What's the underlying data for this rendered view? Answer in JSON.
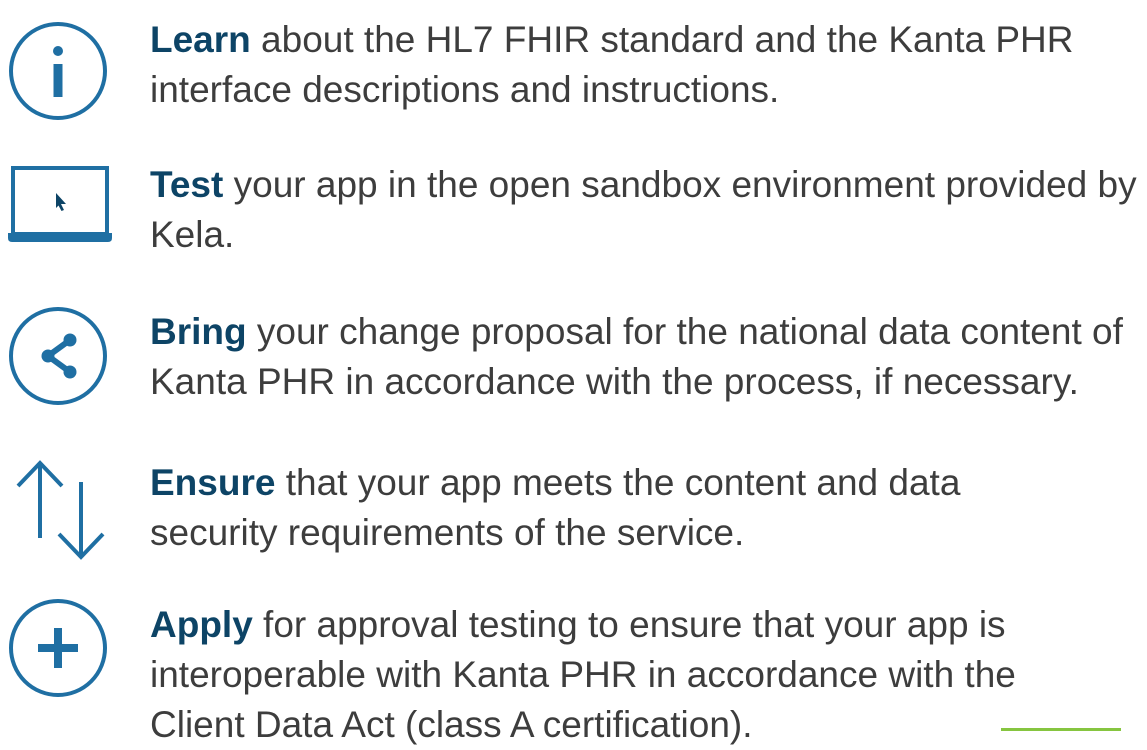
{
  "colors": {
    "icon_blue": "#1f6fa3",
    "heading_navy": "#0d4466",
    "body_text": "#3d3d3d",
    "accent_green": "#86c540"
  },
  "steps": [
    {
      "icon": "info-icon",
      "keyword": "Learn",
      "text": " about the HL7 FHIR standard and the Kanta PHR interface descriptions and instructions."
    },
    {
      "icon": "laptop-cursor-icon",
      "keyword": "Test",
      "text": " your app in the open sandbox environment provided by Kela."
    },
    {
      "icon": "share-icon",
      "keyword": "Bring",
      "text": " your change proposal for the national data content of Kanta PHR in accordance with the process, if necessary."
    },
    {
      "icon": "up-down-arrows-icon",
      "keyword": "Ensure",
      "text": " that your app meets the content and data security requirements of the service."
    },
    {
      "icon": "plus-circle-icon",
      "keyword": "Apply",
      "text": " for approval testing to ensure that your app is interoperable with Kanta PHR in accordance with the Client Data Act (class A certification)."
    }
  ]
}
